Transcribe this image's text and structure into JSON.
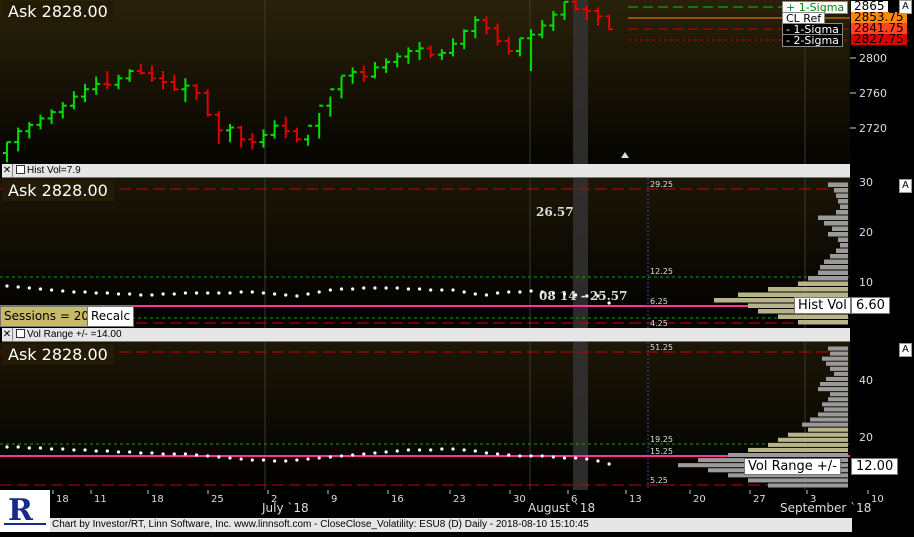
{
  "symbol_line": "Ask 2828.00",
  "panes": {
    "price": {
      "ask_label": "Ask 2828.00",
      "right_ticks": [
        "2800",
        "2760",
        "2720"
      ],
      "overlays": [
        {
          "label": "+ 1-Sigma",
          "value": "2865",
          "bg": "#ffffff",
          "fg": "#008800"
        },
        {
          "label": "CL Ref",
          "value": "2853.75",
          "bg": "#ffffff",
          "fg": "#000000"
        },
        {
          "label": "- 1-Sigma",
          "value": "2841.75",
          "bg": "#000000",
          "fg": "#ffffff"
        },
        {
          "label": "- 2-Sigma",
          "value": "2827.75",
          "bg": "#000000",
          "fg": "#ffffff"
        }
      ]
    },
    "hist_vol": {
      "label": "Hist Vol=7.9",
      "ask_label": "Ask 2828.00",
      "right_ticks": [
        "30",
        "20",
        "10"
      ],
      "peak_label": "26.57",
      "point_label": "08 14 - 25.57",
      "level_labels": [
        "29.25",
        "12.25",
        "6.25",
        "4.25"
      ],
      "sessions_button": "Sessions = 20",
      "recalc_button": "Recalc",
      "overlay_label": "Hist Vol",
      "overlay_value": "6.60"
    },
    "vol_range": {
      "label": "Vol Range +/- =14.00",
      "ask_label": "Ask 2828.00",
      "right_ticks": [
        "40",
        "20"
      ],
      "level_labels": [
        "51.25",
        "19.25",
        "15.25",
        "5.25"
      ],
      "overlay_label": "Vol Range +/-",
      "overlay_value": "12.00"
    }
  },
  "x_axis": {
    "day_ticks": [
      "18",
      "11",
      "18",
      "25",
      "2",
      "9",
      "16",
      "23",
      "30",
      "6",
      "13",
      "20",
      "27",
      "3",
      "10"
    ],
    "month_labels": [
      "July `18",
      "August `18",
      "September `18"
    ]
  },
  "pane_button": "A",
  "footer": "Chart by Investor/RT, Linn Software, Inc. www.linnsoft.com - CloseClose_Volatility: ESU8 (D) Daily - 2018-08-10 15:10:45",
  "colors": {
    "up_bar": "#00e000",
    "down_bar": "#e00000",
    "background_top": "#2a210a",
    "background_bottom": "#000000",
    "magenta_line": "#ff3399",
    "dashed_red": "#cc0000"
  },
  "chart_data": {
    "type": "ohlc",
    "title": "",
    "xlabel": "",
    "ylabel": "",
    "ylim": [
      2688,
      2868
    ],
    "series": [
      {
        "open": [
          2700,
          2712,
          2724,
          2731,
          2738,
          2745,
          2752,
          2762,
          2770,
          2776,
          2775,
          2782,
          2790,
          2788,
          2782,
          2778,
          2770,
          2774,
          2766,
          2742,
          2725,
          2728,
          2715,
          2712,
          2720,
          2730,
          2724,
          2715,
          2730,
          2752,
          2770,
          2785,
          2789,
          2784,
          2794,
          2800,
          2806,
          2812,
          2815,
          2808,
          2810,
          2820,
          2834,
          2846,
          2837,
          2823,
          2812,
          2826,
          2830,
          2840,
          2852,
          2866,
          2858,
          2856,
          2850
        ],
        "high": [
          2712,
          2728,
          2734,
          2742,
          2748,
          2756,
          2768,
          2776,
          2784,
          2790,
          2786,
          2792,
          2798,
          2796,
          2790,
          2786,
          2782,
          2776,
          2770,
          2746,
          2732,
          2730,
          2722,
          2726,
          2736,
          2740,
          2728,
          2720,
          2744,
          2762,
          2784,
          2794,
          2796,
          2800,
          2804,
          2810,
          2816,
          2822,
          2818,
          2814,
          2826,
          2836,
          2850,
          2850,
          2842,
          2828,
          2826,
          2836,
          2846,
          2856,
          2866,
          2870,
          2862,
          2860,
          2852
        ],
        "low": [
          2690,
          2702,
          2716,
          2726,
          2732,
          2738,
          2748,
          2756,
          2764,
          2770,
          2770,
          2778,
          2786,
          2778,
          2770,
          2768,
          2756,
          2758,
          2740,
          2710,
          2712,
          2706,
          2704,
          2706,
          2716,
          2716,
          2712,
          2708,
          2716,
          2740,
          2760,
          2776,
          2778,
          2782,
          2788,
          2794,
          2798,
          2802,
          2804,
          2802,
          2806,
          2814,
          2826,
          2830,
          2818,
          2808,
          2806,
          2790,
          2826,
          2834,
          2846,
          2856,
          2846,
          2840,
          2835
        ],
        "close": [
          2712,
          2724,
          2731,
          2738,
          2745,
          2752,
          2762,
          2770,
          2776,
          2775,
          2782,
          2790,
          2788,
          2782,
          2778,
          2770,
          2774,
          2766,
          2742,
          2725,
          2728,
          2715,
          2712,
          2720,
          2730,
          2724,
          2715,
          2730,
          2752,
          2770,
          2785,
          2789,
          2784,
          2794,
          2800,
          2806,
          2812,
          2815,
          2808,
          2810,
          2820,
          2834,
          2846,
          2837,
          2823,
          2812,
          2826,
          2830,
          2840,
          2852,
          2866,
          2858,
          2856,
          2850,
          2836
        ]
      }
    ]
  }
}
